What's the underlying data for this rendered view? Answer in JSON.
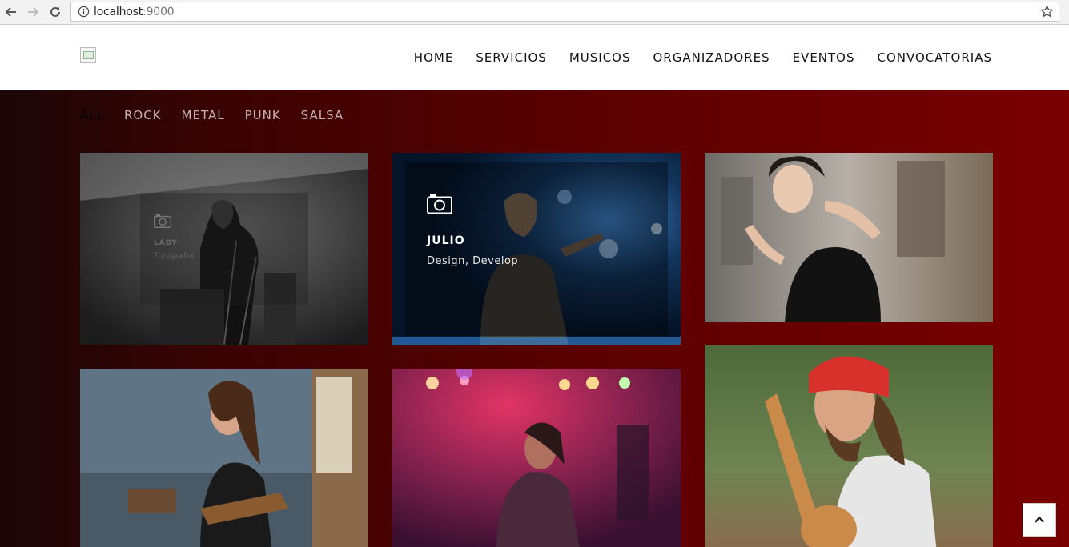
{
  "browser": {
    "url_host": "localhost",
    "url_port": ":9000",
    "icons": [
      "back-icon",
      "forward-icon",
      "reload-icon",
      "info-icon",
      "star-icon"
    ]
  },
  "header": {
    "nav": [
      "HOME",
      "SERVICIOS",
      "MUSICOS",
      "ORGANIZADORES",
      "EVENTOS",
      "CONVOCATORIAS"
    ]
  },
  "filters": {
    "items": [
      "ALL",
      "ROCK",
      "METAL",
      "PUNK",
      "SALSA"
    ],
    "active": "ALL"
  },
  "portfolio": {
    "card1": {
      "title": "LADY",
      "subtitle": "Tipografía"
    },
    "card2": {
      "title": "JULIO",
      "subtitle": "Design, Develop"
    }
  },
  "colors": {
    "brand_dark": "#1a0606",
    "brand_red": "#7a0000"
  }
}
